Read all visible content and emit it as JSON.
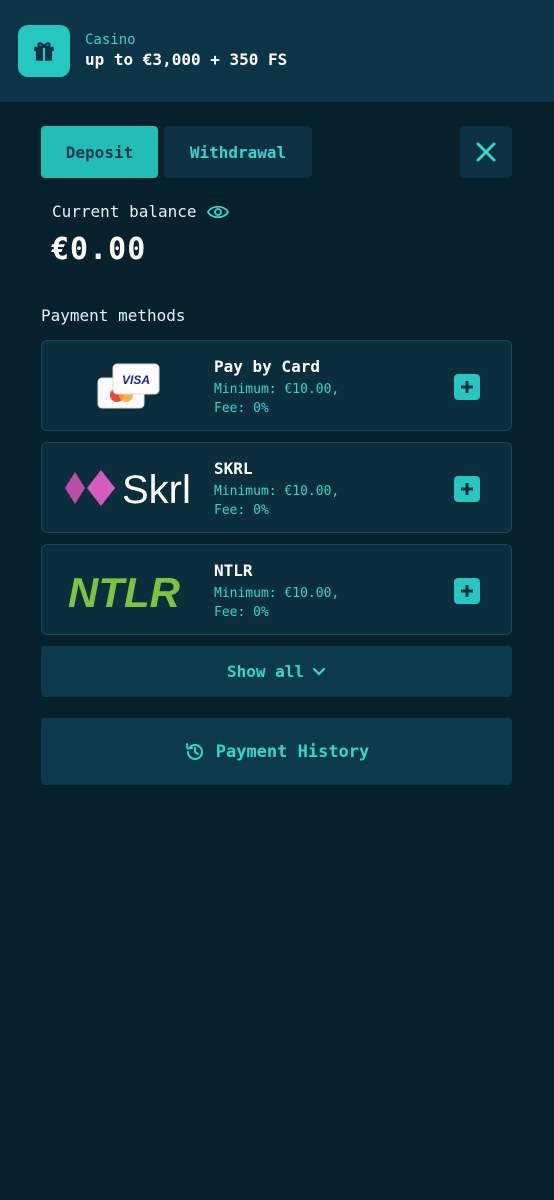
{
  "banner": {
    "icon": "gift-icon",
    "label": "Casino",
    "offer": "up to €3,000 + 350 FS"
  },
  "tabs": {
    "deposit": "Deposit",
    "withdrawal": "Withdrawal",
    "active": "Deposit"
  },
  "balance": {
    "label": "Current balance",
    "value": "€0.00",
    "toggle_icon": "eye-icon"
  },
  "payment_methods": {
    "title": "Payment methods",
    "items": [
      {
        "name": "Pay by Card",
        "minimum": "Minimum: €10.00,",
        "fee": "Fee: 0%",
        "logo": "card-logo",
        "logo_text": "VISA"
      },
      {
        "name": "SKRL",
        "minimum": "Minimum: €10.00,",
        "fee": "Fee: 0%",
        "logo": "skrl-logo",
        "logo_text": "Skrl"
      },
      {
        "name": "NTLR",
        "minimum": "Minimum: €10.00,",
        "fee": "Fee: 0%",
        "logo": "ntlr-logo",
        "logo_text": "NTLR"
      }
    ]
  },
  "show_all": {
    "label": "Show all",
    "icon": "chevron-down-icon"
  },
  "history": {
    "label": "Payment History",
    "icon": "history-icon"
  },
  "colors": {
    "background": "#06202c",
    "banner": "#0b3446",
    "accent": "#25c7c0",
    "accent_text": "#34d6ce",
    "card": "#0b2e3d",
    "skrl_purple": "#b94fa8",
    "ntlr_green": "#7fc241"
  }
}
